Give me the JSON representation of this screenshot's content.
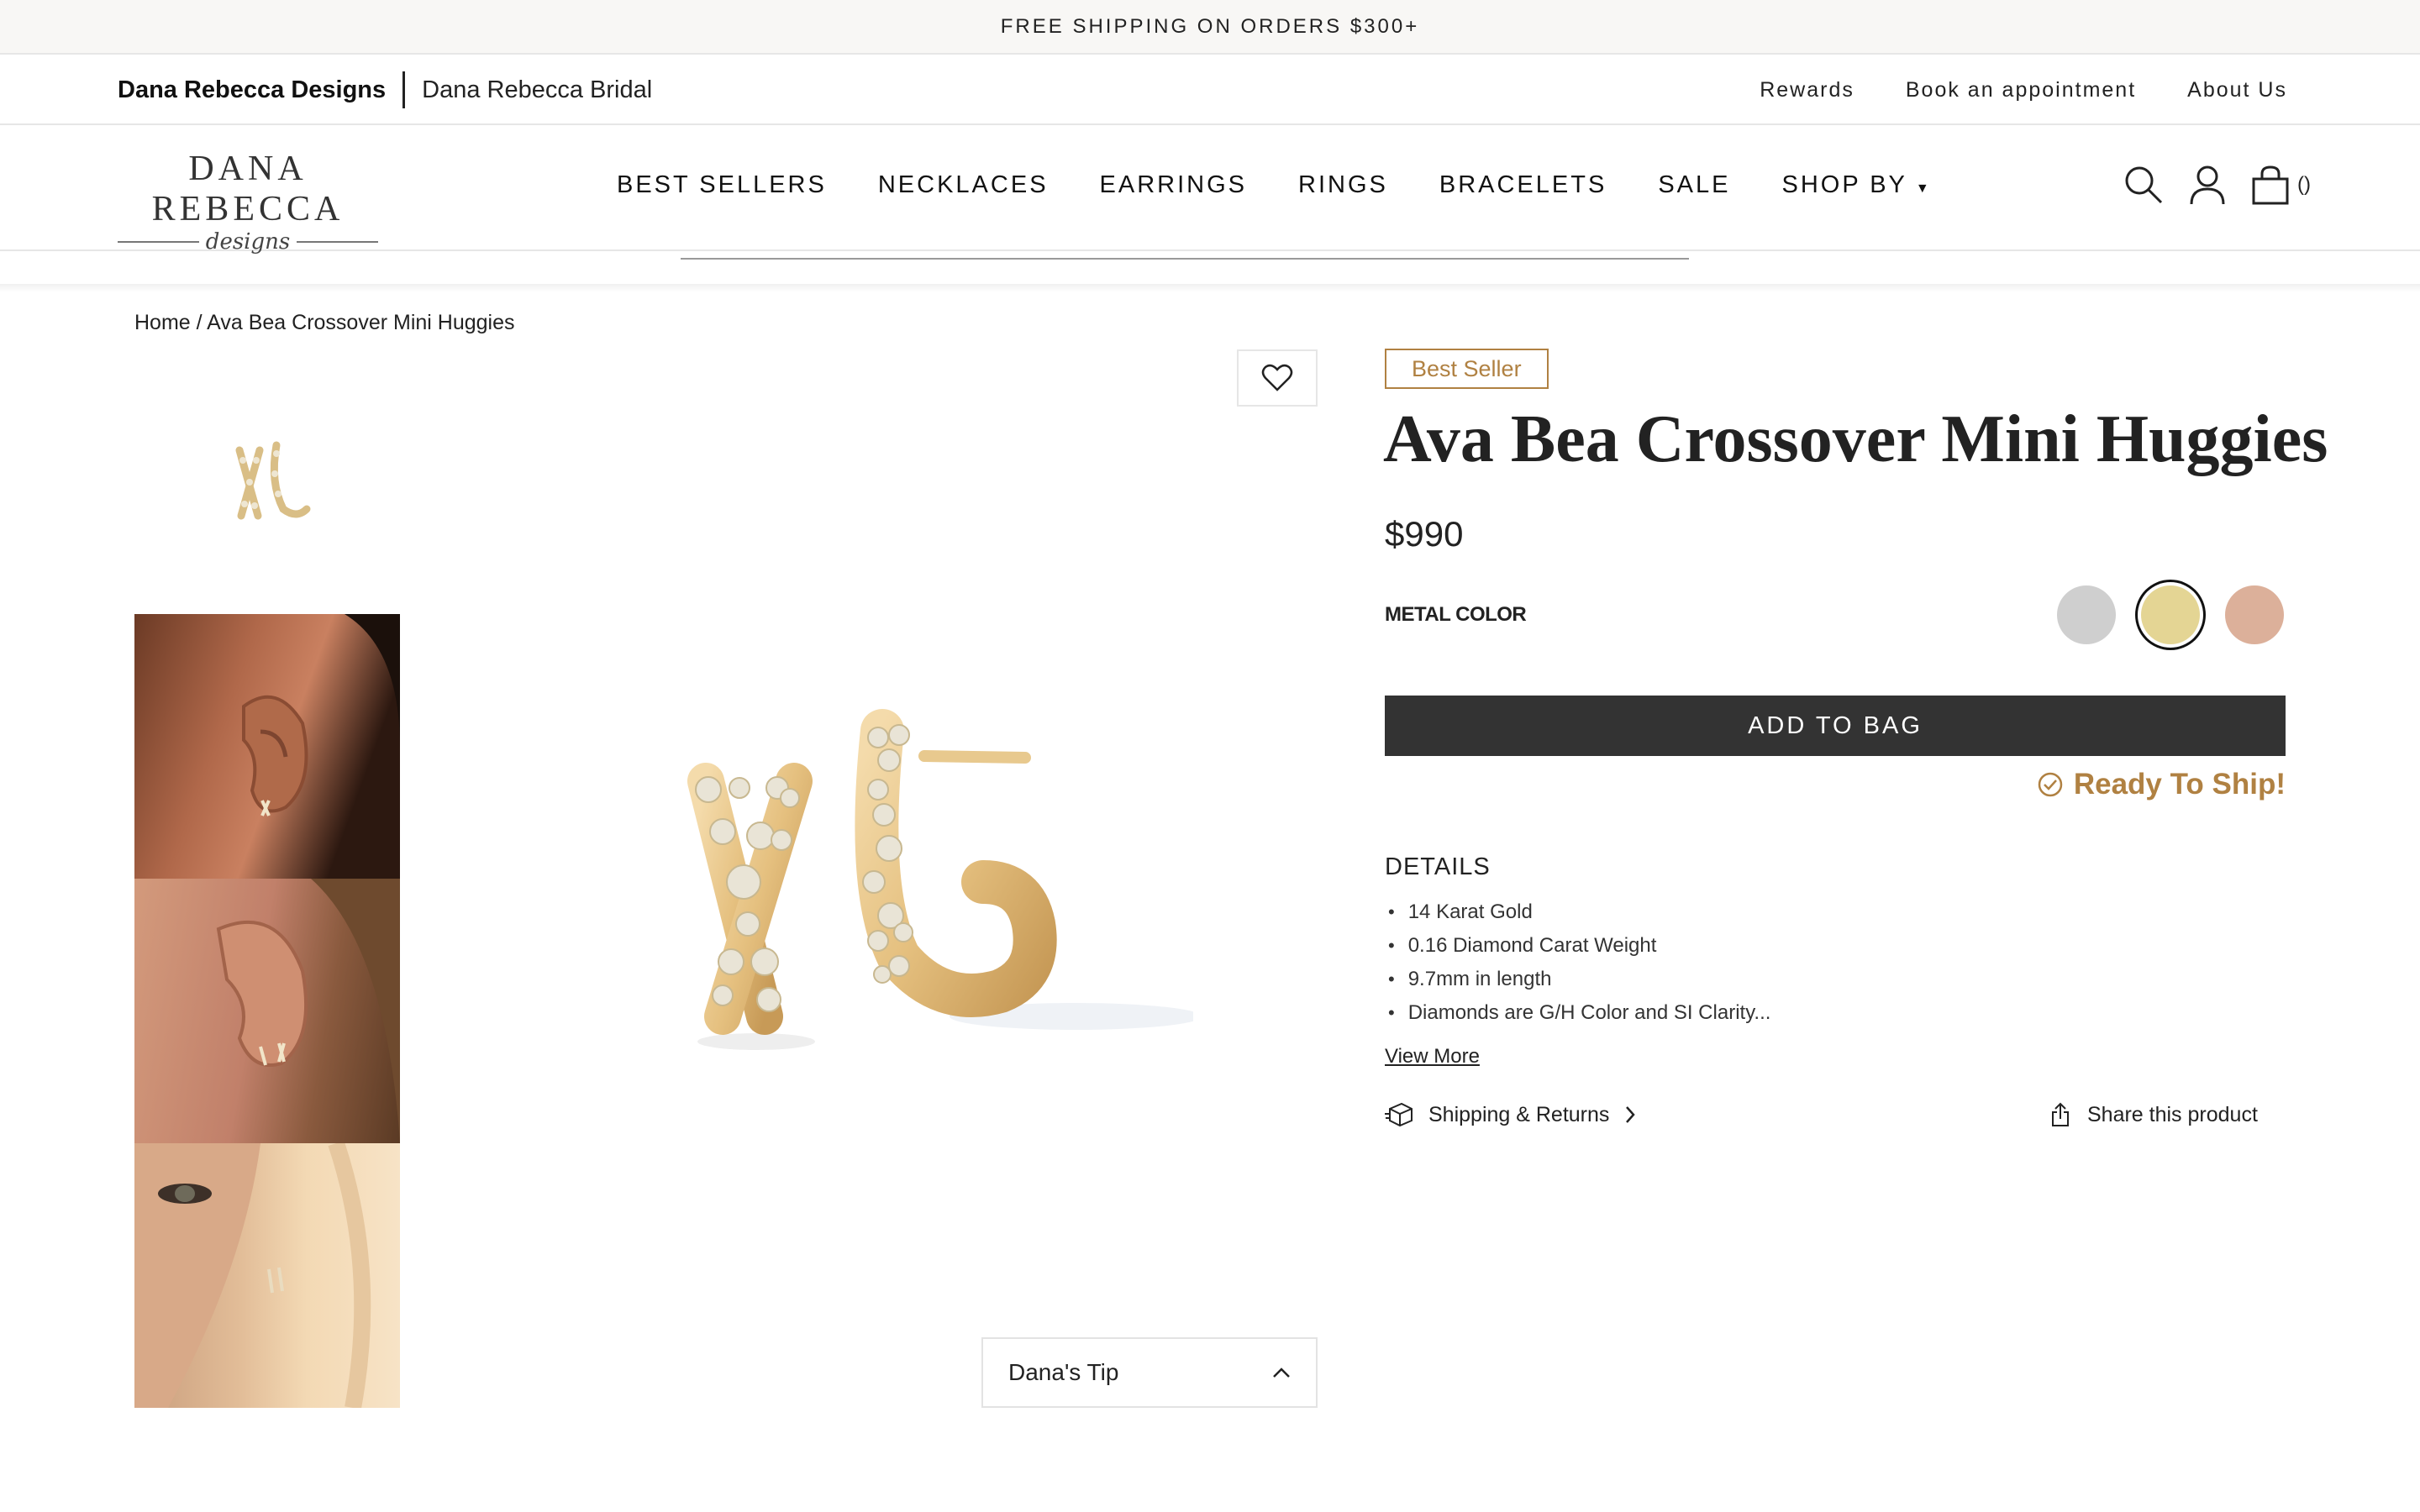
{
  "announcement": "FREE SHIPPING ON ORDERS $300+",
  "brands": {
    "primary": "Dana Rebecca Designs",
    "secondary": "Dana Rebecca Bridal"
  },
  "utility_links": [
    "Rewards",
    "Book an appointment",
    "About Us"
  ],
  "logo": {
    "line1": "DANA REBECCA",
    "line2": "designs"
  },
  "nav": [
    "BEST SELLERS",
    "NECKLACES",
    "EARRINGS",
    "RINGS",
    "BRACELETS",
    "SALE",
    "SHOP BY"
  ],
  "cart": {
    "count": "()"
  },
  "breadcrumb": "Home / Ava Bea Crossover Mini Huggies",
  "product": {
    "badge": "Best Seller",
    "title": "Ava Bea Crossover Mini Huggies",
    "price": "$990",
    "metal_color_label": "METAL COLOR",
    "swatches": [
      {
        "name": "white-gold",
        "color": "#cfcfcf"
      },
      {
        "name": "yellow-gold",
        "color": "#e4d594",
        "selected": true
      },
      {
        "name": "rose-gold",
        "color": "#dcb09a"
      }
    ],
    "add_to_bag": "ADD TO BAG",
    "ready_to_ship": "Ready To Ship!",
    "details_heading": "DETAILS",
    "details": [
      "14 Karat Gold",
      "0.16 Diamond Carat Weight",
      "9.7mm in length",
      "Diamonds are G/H Color and SI Clarity..."
    ],
    "view_more": "View More",
    "shipping_returns": "Shipping & Returns",
    "share": "Share this product",
    "tip": "Dana's Tip"
  },
  "colors": {
    "accent": "#b08142",
    "button": "#333333"
  }
}
